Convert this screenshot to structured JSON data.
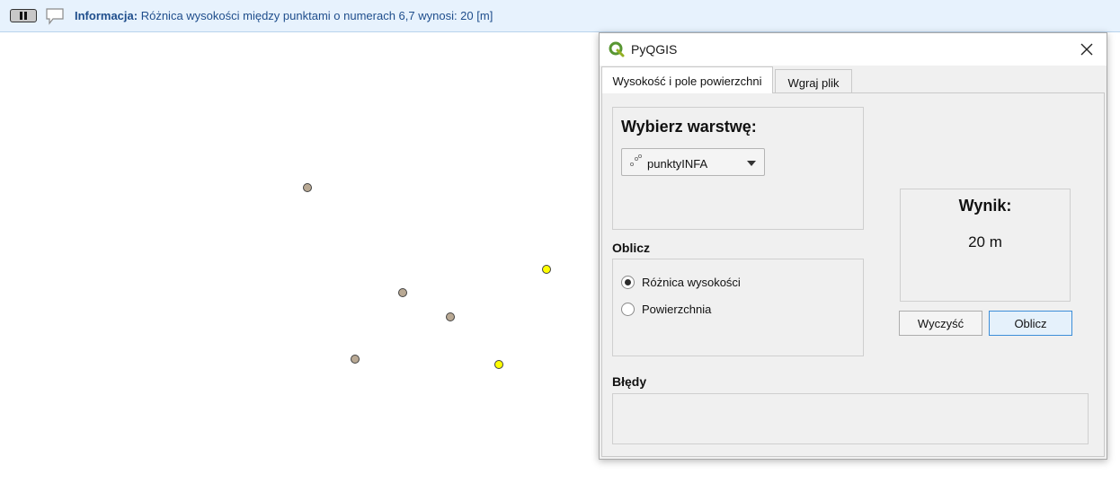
{
  "message_bar": {
    "title": "Informacja:",
    "text": "Różnica wysokości między punktami o numerach 6,7 wynosi: 20 [m]"
  },
  "map": {
    "point_colors": {
      "default": "#b9a994",
      "selected": "#ffff00"
    }
  },
  "dialog": {
    "window_title": "PyQGIS",
    "tabs": [
      {
        "label": "Wysokość i pole powierzchni",
        "active": true
      },
      {
        "label": "Wgraj plik",
        "active": false
      }
    ],
    "layer_group": {
      "title": "Wybierz warstwę:",
      "selected_layer": "punktyINFA"
    },
    "calc_section": {
      "label": "Oblicz",
      "options": [
        {
          "label": "Różnica wysokości",
          "checked": true
        },
        {
          "label": "Powierzchnia",
          "checked": false
        }
      ]
    },
    "result": {
      "title": "Wynik:",
      "value": "20 m"
    },
    "buttons": {
      "clear": "Wyczyść",
      "calculate": "Oblicz"
    },
    "errors": {
      "label": "Błędy",
      "text": ""
    }
  }
}
